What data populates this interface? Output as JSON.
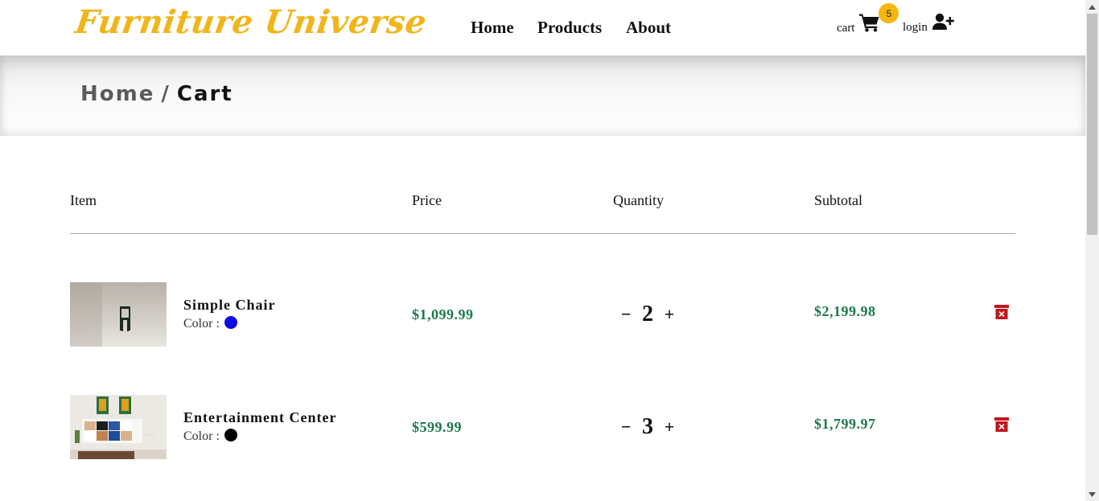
{
  "brand": {
    "logo_text": "Furniture Universe",
    "color": "#f0b51a"
  },
  "nav": {
    "links": [
      {
        "label": "Home"
      },
      {
        "label": "Products"
      },
      {
        "label": "About"
      }
    ]
  },
  "header": {
    "cart_label": "cart",
    "cart_count": "5",
    "login_label": "login",
    "badge_color": "#f5b70c"
  },
  "breadcrumb": {
    "home": "Home",
    "separator": "/",
    "current": "Cart"
  },
  "table": {
    "columns": [
      "Item",
      "Price",
      "Quantity",
      "Subtotal"
    ],
    "rows": [
      {
        "name": "Simple Chair",
        "color_label": "Color :",
        "color": "#0a0ae6",
        "price": "$1,099.99",
        "quantity": "2",
        "subtotal": "$2,199.98"
      },
      {
        "name": "Entertainment Center",
        "color_label": "Color :",
        "color": "#000000",
        "price": "$599.99",
        "quantity": "3",
        "subtotal": "$1,799.97"
      }
    ],
    "decrement": "−",
    "increment": "+"
  },
  "colors": {
    "price": "#1b7a4a",
    "remove": "#c0161e"
  }
}
